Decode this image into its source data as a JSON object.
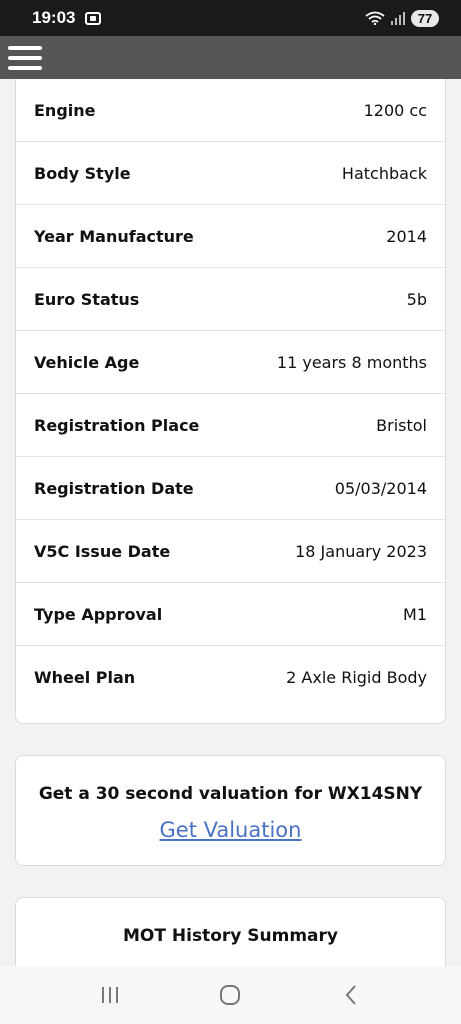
{
  "status_bar": {
    "time": "19:03",
    "battery": "77"
  },
  "vehicle_details": [
    {
      "label": "Engine",
      "value": "1200 cc"
    },
    {
      "label": "Body Style",
      "value": "Hatchback"
    },
    {
      "label": "Year Manufacture",
      "value": "2014"
    },
    {
      "label": "Euro Status",
      "value": "5b"
    },
    {
      "label": "Vehicle Age",
      "value": "11 years 8 months"
    },
    {
      "label": "Registration Place",
      "value": "Bristol"
    },
    {
      "label": "Registration Date",
      "value": "05/03/2014"
    },
    {
      "label": "V5C Issue Date",
      "value": "18 January 2023"
    },
    {
      "label": "Type Approval",
      "value": "M1"
    },
    {
      "label": "Wheel Plan",
      "value": "2 Axle Rigid Body"
    }
  ],
  "valuation": {
    "text": "Get a 30 second valuation for WX14SNY",
    "link_label": "Get Valuation"
  },
  "mot": {
    "title": "MOT History Summary"
  },
  "colors": {
    "header_bg": "#555555",
    "link": "#4a72c4"
  }
}
